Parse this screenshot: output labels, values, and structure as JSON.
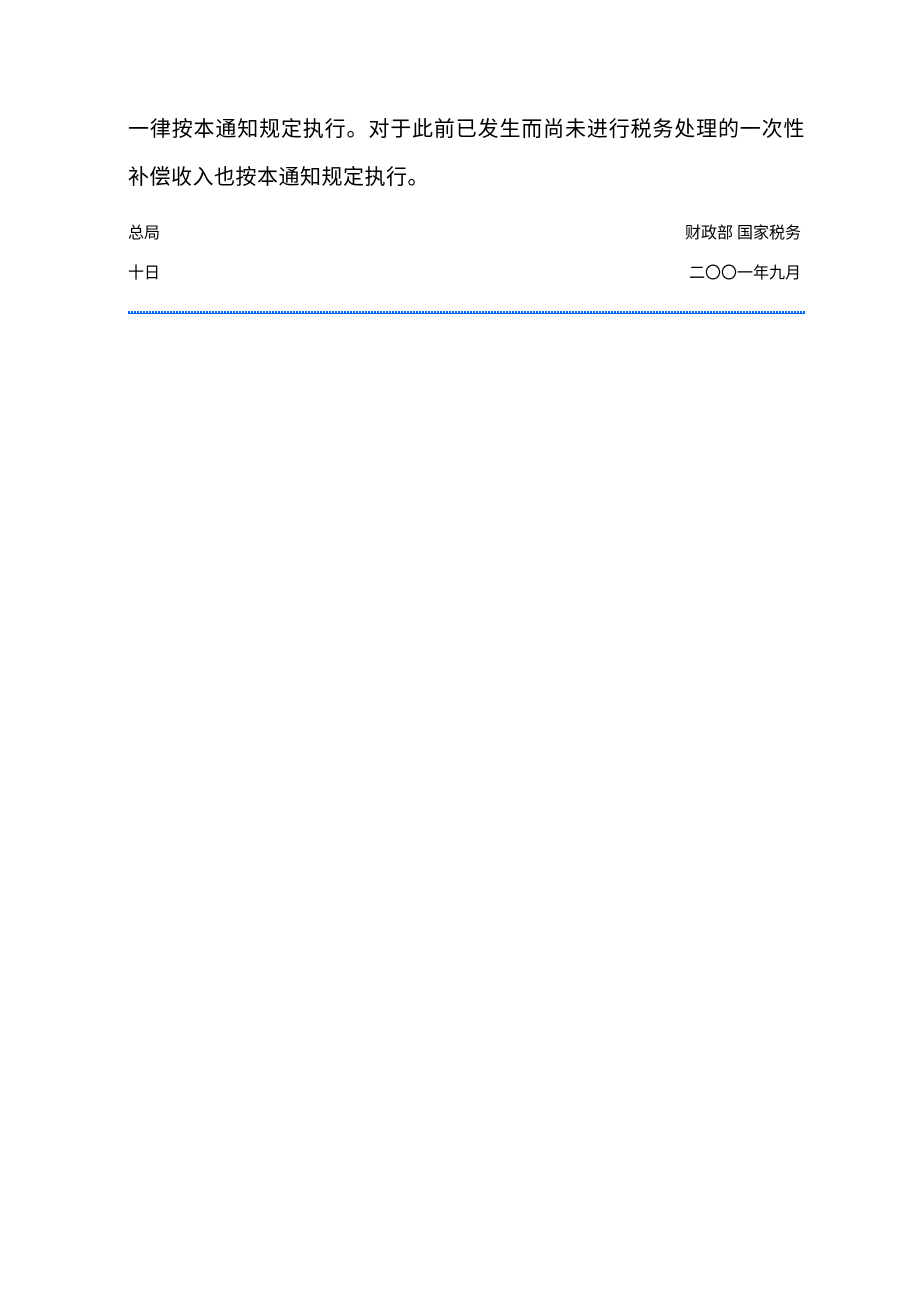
{
  "document": {
    "paragraph": "一律按本通知规定执行。对于此前已发生而尚未进行税务处理的一次性补偿收入也按本通知规定执行。",
    "signature1_right": "财政部 国家税务",
    "signature1_left": "总局",
    "signature2_right": "二〇〇一年九月",
    "signature2_left": "十日"
  }
}
